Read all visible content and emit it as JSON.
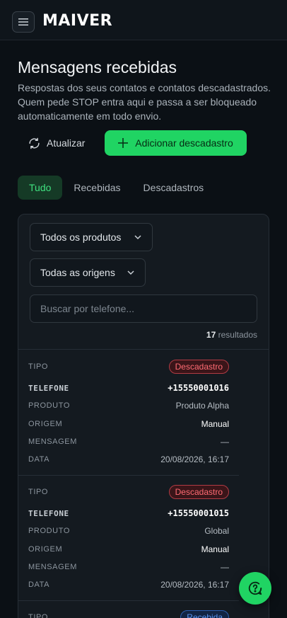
{
  "header": {
    "logo_text": "MAIVER",
    "menu_icon": "hamburger-icon"
  },
  "page": {
    "title": "Mensagens recebidas",
    "subtitle": "Respostas dos seus contatos e contatos descadastrados. Quem pede STOP entra aqui e passa a ser bloqueado automaticamente em todo envio."
  },
  "actions": {
    "refresh_label": "Atualizar",
    "refresh_icon": "refresh-icon",
    "add_label": "Adicionar descadastro",
    "add_icon": "plus-icon"
  },
  "tabs": [
    {
      "label": "Tudo",
      "active": true
    },
    {
      "label": "Recebidas",
      "active": false
    },
    {
      "label": "Descadastros",
      "active": false
    }
  ],
  "filters": {
    "product_select": "Todos os produtos",
    "origin_select": "Todas as origens",
    "search_placeholder": "Buscar por telefone...",
    "results_count": "17",
    "results_label": "resultados"
  },
  "labels": {
    "tipo": "TIPO",
    "telefone": "TELEFONE",
    "produto": "PRODUTO",
    "origem": "ORIGEM",
    "mensagem": "MENSAGEM",
    "data": "DATA"
  },
  "rows": [
    {
      "tipo": "Descadastro",
      "telefone": "+15550001016",
      "produto": "Produto Alpha",
      "origem": "Manual",
      "mensagem": "—",
      "data": "20/08/2026, 16:17"
    },
    {
      "tipo": "Descadastro",
      "telefone": "+15550001015",
      "produto": "Global",
      "origem": "Manual",
      "mensagem": "—",
      "data": "20/08/2026, 16:17"
    },
    {
      "tipo": "Recebida"
    }
  ],
  "colors": {
    "accent_green": "#20d463",
    "danger_red": "#ff6b73",
    "info_blue": "#5a93f0"
  },
  "help_icon": "help-circle-icon"
}
